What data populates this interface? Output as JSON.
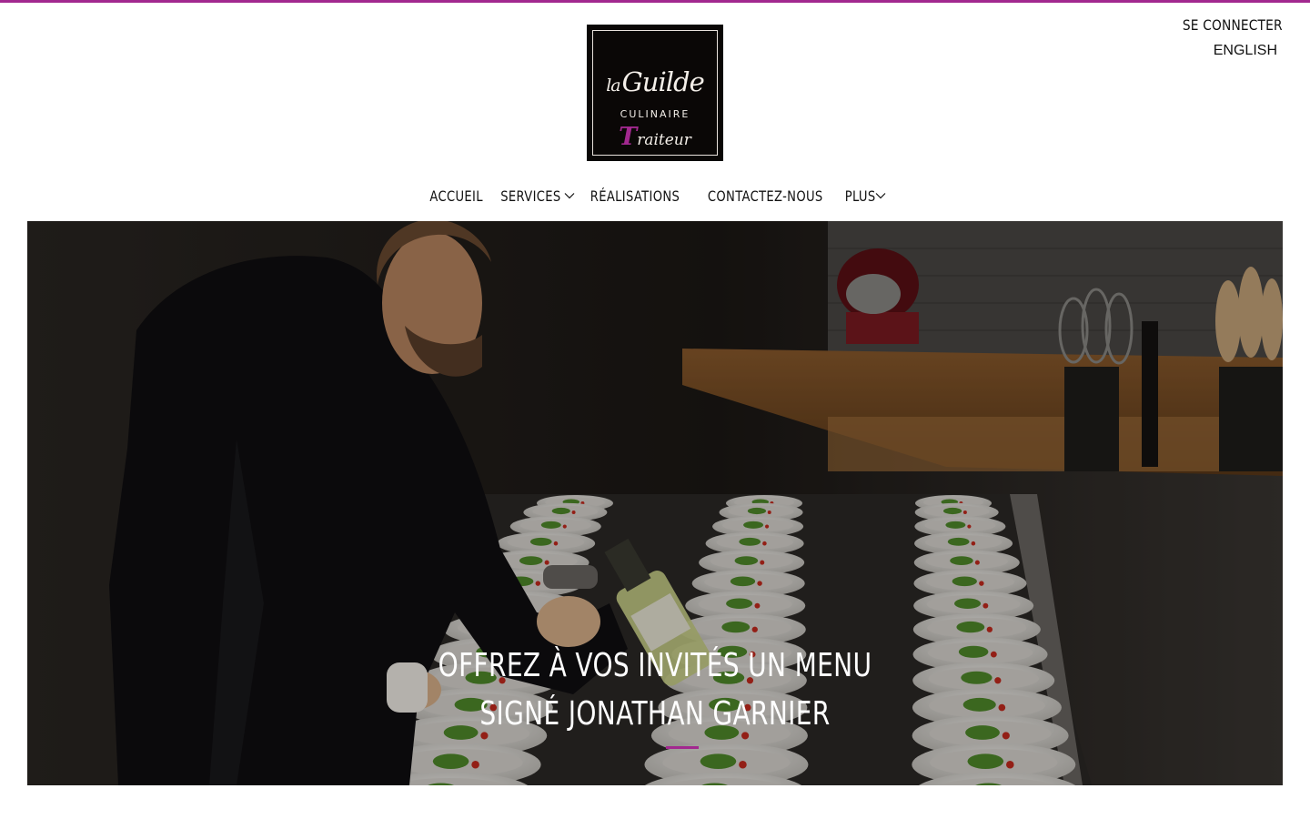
{
  "header": {
    "account": {
      "login_label": "SE CONNECTER",
      "language_label": "ENGLISH"
    },
    "logo": {
      "line1_small": "la",
      "line1": "Guilde",
      "line2": "CULINAIRE",
      "line3_initial": "T",
      "line3_rest": "raiteur"
    }
  },
  "nav": {
    "items": [
      {
        "label": "ACCUEIL",
        "has_dropdown": false
      },
      {
        "label": "SERVICES",
        "has_dropdown": true
      },
      {
        "label": "RÉALISATIONS",
        "has_dropdown": false
      },
      {
        "label": "CONTACTEZ-NOUS",
        "has_dropdown": false
      },
      {
        "label": "PLUS",
        "has_dropdown": true
      }
    ]
  },
  "hero": {
    "title_line1": "OFFREZ À VOS INVITÉS UN MENU",
    "title_line2": "SIGNÉ JONATHAN GARNIER"
  },
  "colors": {
    "accent": "#a2288f",
    "text": "#111111",
    "background": "#ffffff",
    "logo_bg": "#0a0706"
  },
  "icons": {
    "dropdown": "chevron-down-icon"
  }
}
